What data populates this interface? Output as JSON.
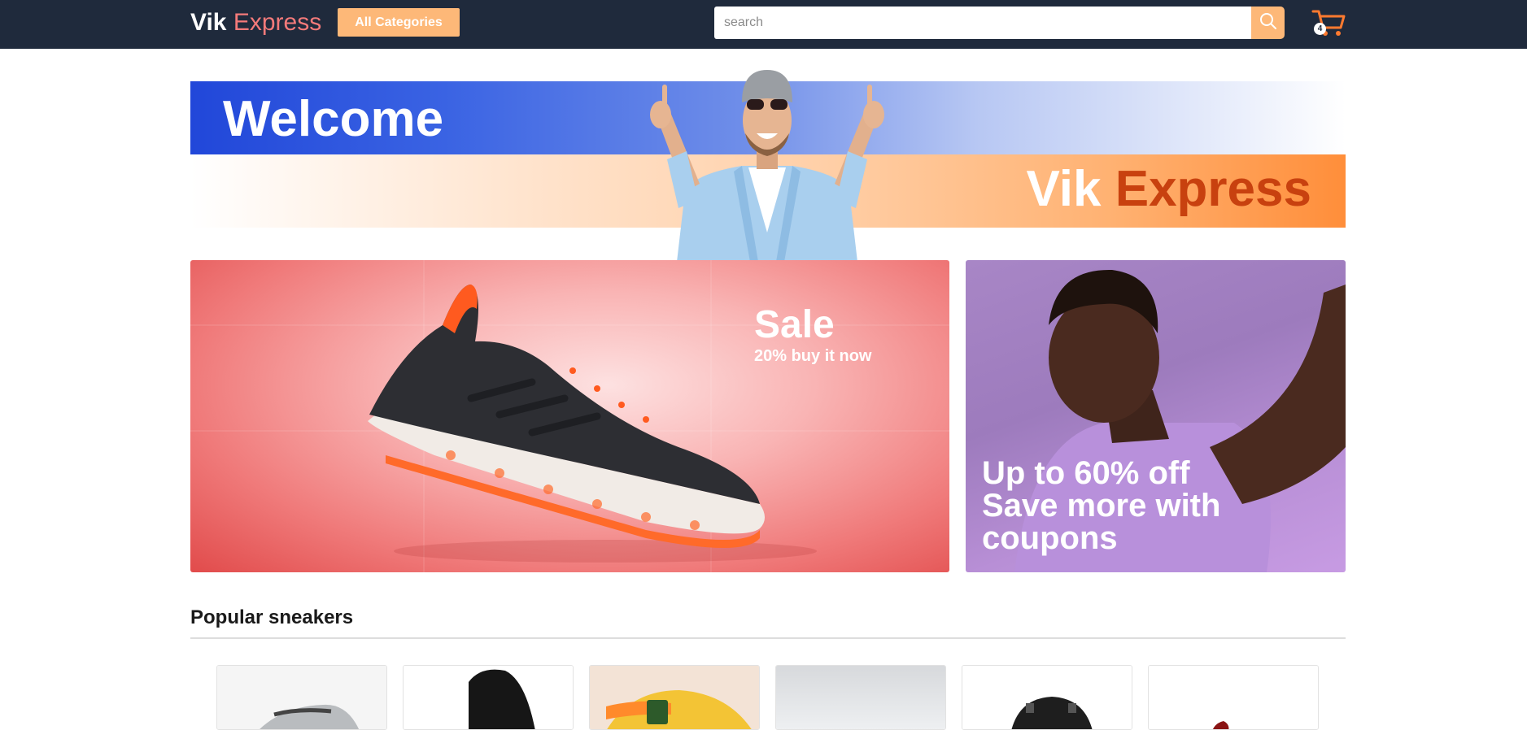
{
  "header": {
    "logo_part1": "Vik",
    "logo_part2": "Express",
    "categories_label": "All Categories",
    "search_placeholder": "search",
    "search_icon": "search-icon",
    "cart_icon": "cart-icon",
    "cart_count": "4"
  },
  "banner": {
    "welcome": "Welcome",
    "brand_part1": "Vik",
    "brand_part2": "Express"
  },
  "sale_card": {
    "title": "Sale",
    "subtitle": "20% buy it now"
  },
  "promo_card": {
    "line1": "Up to 60% off",
    "line2": "Save more with",
    "line3": "coupons"
  },
  "popular": {
    "title": "Popular sneakers",
    "products": [
      {
        "name": "silver-sneaker"
      },
      {
        "name": "black-high-top-sneaker"
      },
      {
        "name": "yellow-puma-sneaker"
      },
      {
        "name": "grey-sneaker"
      },
      {
        "name": "black-sneaker"
      },
      {
        "name": "red-sneaker"
      }
    ]
  },
  "colors": {
    "header_bg": "#1f2a3c",
    "accent_orange": "#fdb878",
    "logo_pink": "#f47a7a",
    "brand_orange": "#c8410f",
    "banner_blue": "#2147d9"
  }
}
